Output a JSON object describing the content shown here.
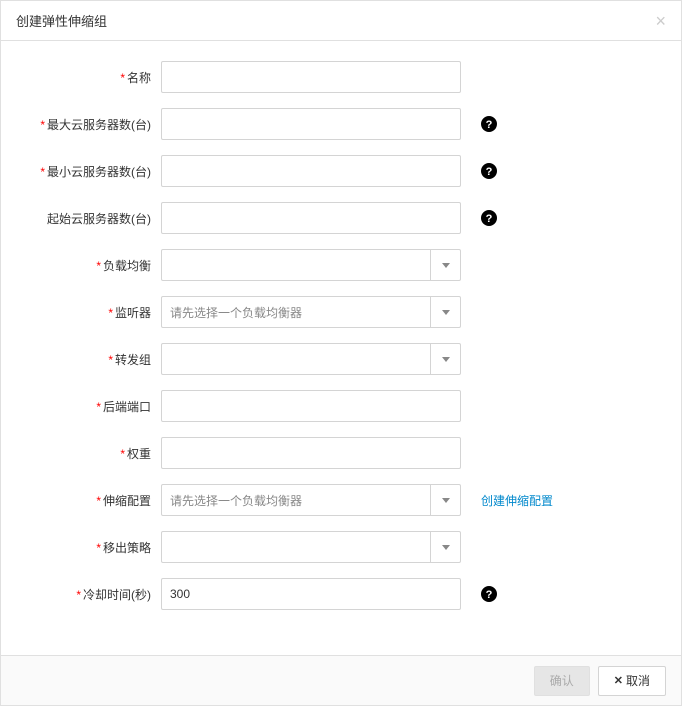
{
  "header": {
    "title": "创建弹性伸缩组"
  },
  "fields": {
    "name": {
      "label": "名称",
      "required": true
    },
    "maxServers": {
      "label": "最大云服务器数(台)",
      "required": true
    },
    "minServers": {
      "label": "最小云服务器数(台)",
      "required": true
    },
    "initialServers": {
      "label": "起始云服务器数(台)",
      "required": false
    },
    "loadBalancer": {
      "label": "负载均衡",
      "required": true
    },
    "listener": {
      "label": "监听器",
      "required": true,
      "placeholder": "请先选择一个负载均衡器"
    },
    "forwardGroup": {
      "label": "转发组",
      "required": true
    },
    "backendPort": {
      "label": "后端端口",
      "required": true
    },
    "weight": {
      "label": "权重",
      "required": true
    },
    "scalingConfig": {
      "label": "伸缩配置",
      "required": true,
      "placeholder": "请先选择一个负载均衡器",
      "link": "创建伸缩配置"
    },
    "removalPolicy": {
      "label": "移出策略",
      "required": true
    },
    "cooldown": {
      "label": "冷却时间(秒)",
      "required": true,
      "value": "300"
    }
  },
  "footer": {
    "confirm": "确认",
    "cancel": "取消"
  }
}
